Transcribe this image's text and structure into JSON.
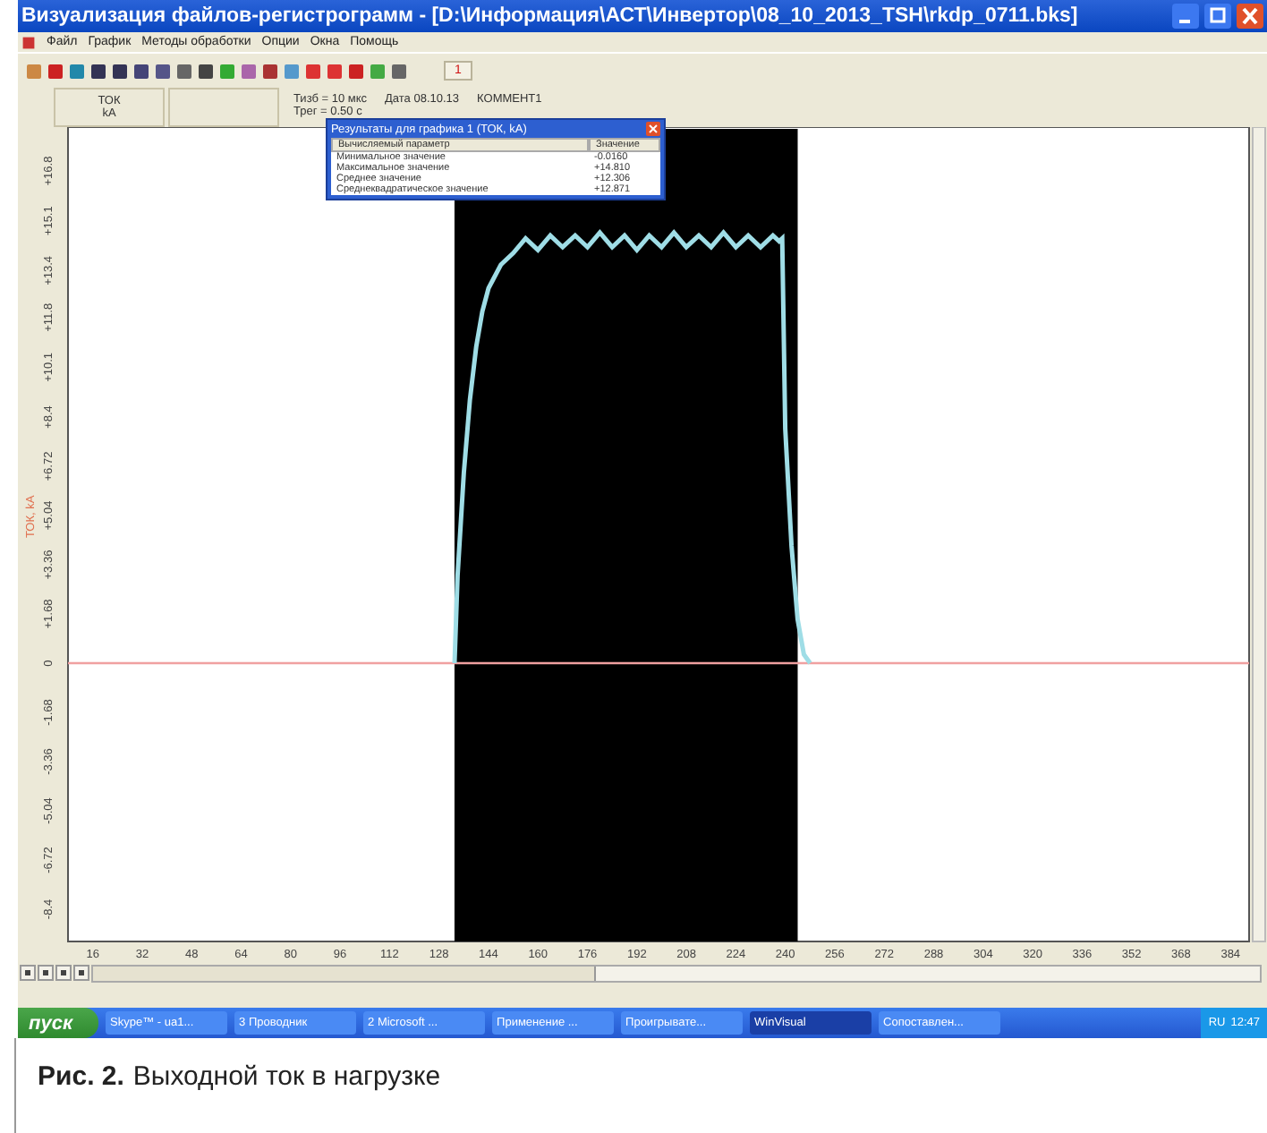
{
  "window": {
    "title": "Визуализация файлов-регистрограмм - [D:\\Информация\\АСТ\\Инвертор\\08_10_2013_TSH\\rkdp_0711.bks]"
  },
  "menu": [
    {
      "label": "Файл"
    },
    {
      "label": "График"
    },
    {
      "label": "Методы обработки"
    },
    {
      "label": "Опции"
    },
    {
      "label": "Окна"
    },
    {
      "label": "Помощь"
    }
  ],
  "toolbar": {
    "counter": "1"
  },
  "info_bar": {
    "channel": "ТОК",
    "unit": "kA",
    "sampling": "Тизб = 10 мкс",
    "record": "Трег = 0.50 с",
    "date": "Дата  08.10.13",
    "comment": "КОММЕНТ1"
  },
  "results_dialog": {
    "title": "Результаты для графика 1 (ТОК, kA)",
    "columns": [
      "Вычисляемый параметр",
      "Значение"
    ],
    "rows": [
      [
        "Минимальное значение",
        "-0.0160"
      ],
      [
        "Максимальное значение",
        "+14.810"
      ],
      [
        "Среднее значение",
        "+12.306"
      ],
      [
        "Среднеквадратическое значение",
        "+12.871"
      ]
    ]
  },
  "chart_data": {
    "type": "line",
    "ylabel": "ТОК, kA",
    "xlim": [
      8,
      390
    ],
    "ylim": [
      -9.5,
      18.3
    ],
    "xticks": [
      16,
      32,
      48,
      64,
      80,
      96,
      112,
      128,
      144,
      160,
      176,
      192,
      208,
      224,
      240,
      256,
      272,
      288,
      304,
      320,
      336,
      352,
      368,
      384
    ],
    "yticks": [
      {
        "value": 16.8,
        "label": "+16.8"
      },
      {
        "value": 15.1,
        "label": "+15.1"
      },
      {
        "value": 13.4,
        "label": "+13.4"
      },
      {
        "value": 11.8,
        "label": "+11.8"
      },
      {
        "value": 10.1,
        "label": "+10.1"
      },
      {
        "value": 8.4,
        "label": "+8.4"
      },
      {
        "value": 6.72,
        "label": "+6.72"
      },
      {
        "value": 5.04,
        "label": "+5.04"
      },
      {
        "value": 3.36,
        "label": "+3.36"
      },
      {
        "value": 1.68,
        "label": "+1.68"
      },
      {
        "value": 0,
        "label": "0"
      },
      {
        "value": -1.68,
        "label": "-1.68"
      },
      {
        "value": -3.36,
        "label": "-3.36"
      },
      {
        "value": -5.04,
        "label": "-5.04"
      },
      {
        "value": -6.72,
        "label": "-6.72"
      },
      {
        "value": -8.4,
        "label": "-8.4"
      }
    ],
    "x": [
      133,
      134,
      136,
      138,
      140,
      142,
      144,
      148,
      152,
      156,
      160,
      164,
      168,
      172,
      176,
      180,
      184,
      188,
      192,
      196,
      200,
      204,
      208,
      212,
      216,
      220,
      224,
      228,
      232,
      236,
      238,
      239,
      240,
      242,
      244,
      246,
      248
    ],
    "series": [
      {
        "color": "#9fdde6",
        "values": [
          0,
          3,
          6.5,
          9,
          10.8,
          12,
          12.8,
          13.6,
          14.0,
          14.5,
          14.1,
          14.6,
          14.2,
          14.6,
          14.2,
          14.7,
          14.2,
          14.6,
          14.1,
          14.6,
          14.2,
          14.7,
          14.2,
          14.6,
          14.2,
          14.7,
          14.2,
          14.6,
          14.2,
          14.6,
          14.4,
          14.5,
          8,
          4,
          1.5,
          0.3,
          0
        ]
      }
    ],
    "bands": [
      {
        "axis": "x",
        "from": 133,
        "to": 244,
        "color": "#000000"
      }
    ],
    "ref_lines": [
      {
        "axis": "y",
        "value": 0,
        "color": "#f0a0a0"
      }
    ]
  },
  "taskbar": {
    "start": "пуск",
    "items": [
      {
        "label": "Skype™ - ua1...",
        "selected": false
      },
      {
        "label": "3 Проводник",
        "selected": false
      },
      {
        "label": "2 Microsoft ...",
        "selected": false
      },
      {
        "label": "Применение ...",
        "selected": false
      },
      {
        "label": "Проигрывате...",
        "selected": false
      },
      {
        "label": "WinVisual",
        "selected": true
      },
      {
        "label": "Сопоставлен...",
        "selected": false
      }
    ],
    "language": "RU",
    "time": "12:47"
  },
  "caption": {
    "label": "Рис. 2.",
    "text": "Выходной ток в нагрузке"
  }
}
